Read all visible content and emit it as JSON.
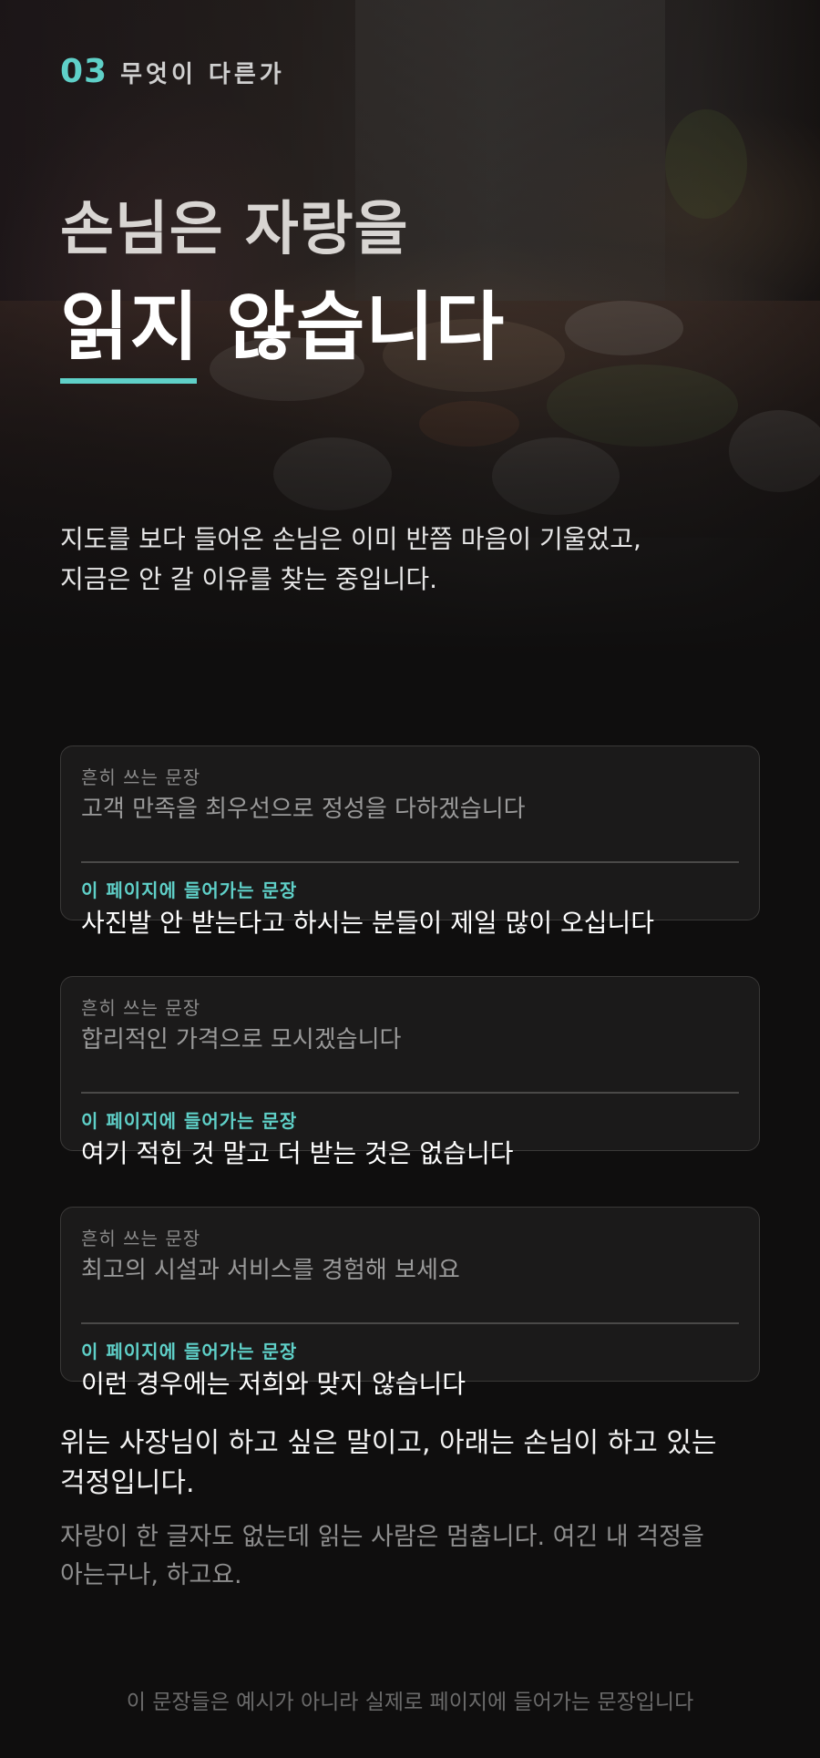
{
  "section": {
    "number": "03",
    "label": "무엇이 다른가"
  },
  "title": {
    "line1": "손님은 자랑을",
    "line2": "읽지 않습니다"
  },
  "intro": {
    "line1": "지도를 보다 들어온 손님은 이미 반쯤 마음이 기울었고,",
    "line2": "지금은 안 갈 이유를 찾는 중입니다."
  },
  "cards": [
    {
      "common_label": "흔히 쓰는 문장",
      "common_text": "고객 만족을 최우선으로 정성을 다하겠습니다",
      "page_label": "이 페이지에 들어가는 문장",
      "page_text": "사진발 안 받는다고 하시는 분들이 제일 많이 오십니다"
    },
    {
      "common_label": "흔히 쓰는 문장",
      "common_text": "합리적인 가격으로 모시겠습니다",
      "page_label": "이 페이지에 들어가는 문장",
      "page_text": "여기 적힌 것 말고 더 받는 것은 없습니다"
    },
    {
      "common_label": "흔히 쓰는 문장",
      "common_text": "최고의 시설과 서비스를 경험해 보세요",
      "page_label": "이 페이지에 들어가는 문장",
      "page_text": "이런 경우에는 저희와 맞지 않습니다"
    }
  ],
  "summary": {
    "line1": "위는 사장님이 하고 싶은 말이고, 아래는 손님이 하고 있는",
    "line2": "걱정입니다.",
    "sub_line1": "자랑이 한 글자도 없는데 읽는 사람은 멈춥니다. 여긴 내 걱정을",
    "sub_line2": "아는구나, 하고요."
  },
  "footer_note": "이 문장들은 예시가 아니라 실제로 페이지에 들어가는 문장입니다",
  "colors": {
    "accent": "#5fd0c8",
    "background": "#0f0e0e",
    "card_background": "#1b1a1a"
  }
}
